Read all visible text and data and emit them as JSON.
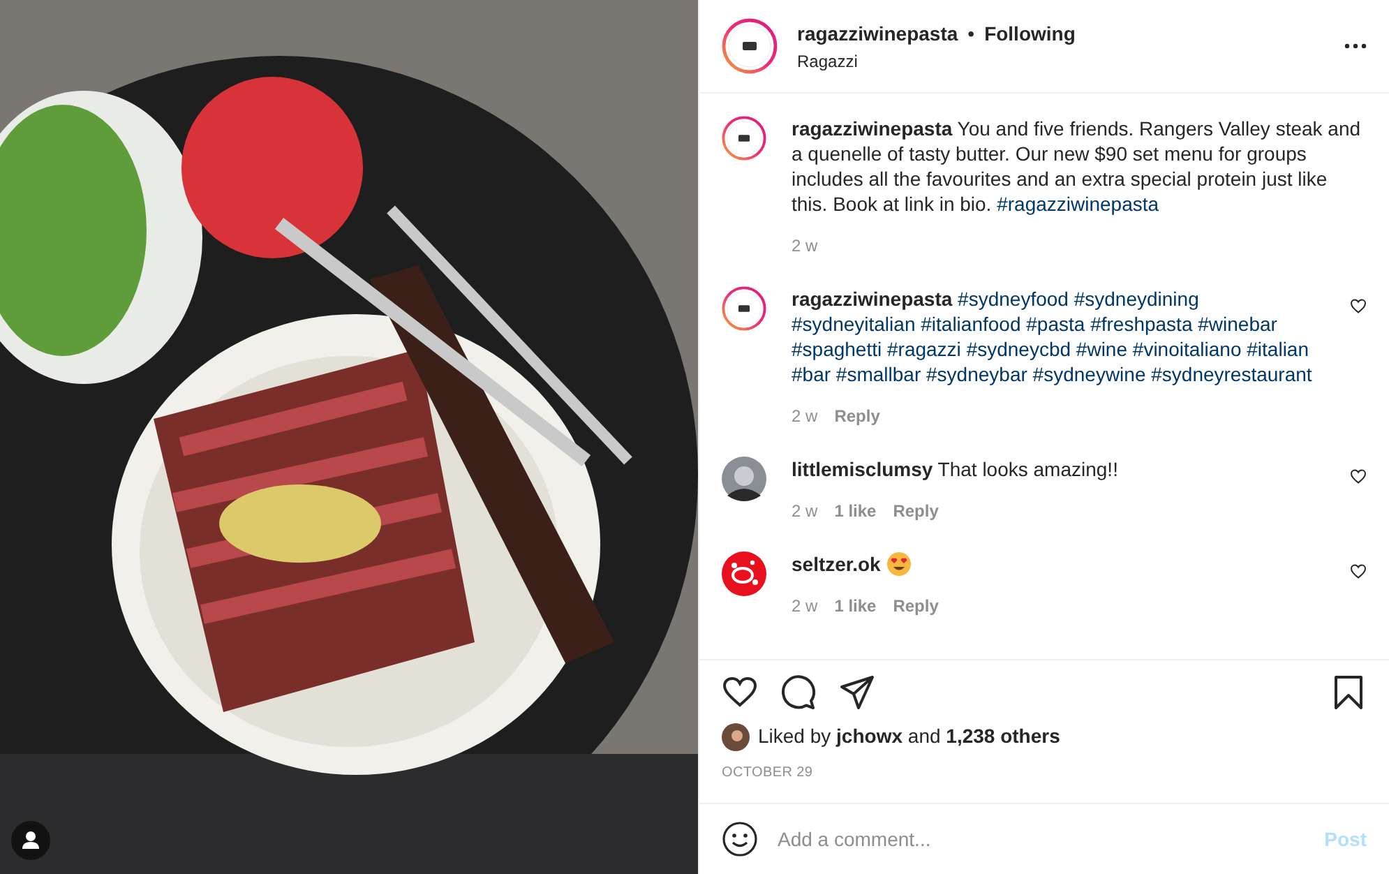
{
  "header": {
    "username": "ragazziwinepasta",
    "separator": "•",
    "follow_status": "Following",
    "location": "Ragazzi"
  },
  "comments": [
    {
      "kind": "caption",
      "avatar": {
        "kind": "story-logo"
      },
      "username": "ragazziwinepasta",
      "text": "You and five friends. Rangers Valley steak and a quenelle of tasty butter. Our new $90 set menu for groups includes all the favourites and an extra special protein just like this. Book at link in bio.",
      "hashtags": [
        "#ragazziwinepasta"
      ],
      "time": "2 w"
    },
    {
      "kind": "comment",
      "avatar": {
        "kind": "story-logo"
      },
      "username": "ragazziwinepasta",
      "hashtags": [
        "#sydneyfood",
        "#sydneydining",
        "#sydneyitalian",
        "#italianfood",
        "#pasta",
        "#freshpasta",
        "#winebar",
        "#spaghetti",
        "#ragazzi",
        "#sydneycbd",
        "#wine",
        "#vinoitaliano",
        "#italian",
        "#bar",
        "#smallbar",
        "#sydneybar",
        "#sydneywine",
        "#sydneyrestaurant"
      ],
      "time": "2 w",
      "reply": "Reply"
    },
    {
      "kind": "comment",
      "avatar": {
        "kind": "photo"
      },
      "username": "littlemisclumsy",
      "text": "That looks amazing!!",
      "time": "2 w",
      "likes": "1 like",
      "reply": "Reply"
    },
    {
      "kind": "emoji-comment",
      "avatar": {
        "kind": "red-logo"
      },
      "username": "seltzer.ok",
      "time": "2 w",
      "likes": "1 like",
      "reply": "Reply"
    }
  ],
  "likes": {
    "text": "Liked by **jchowx** and **1,238 others**"
  },
  "date": "OCTOBER 29",
  "comment_field": {
    "placeholder": "Add a comment...",
    "post_button": "Post",
    "disabled": true
  }
}
